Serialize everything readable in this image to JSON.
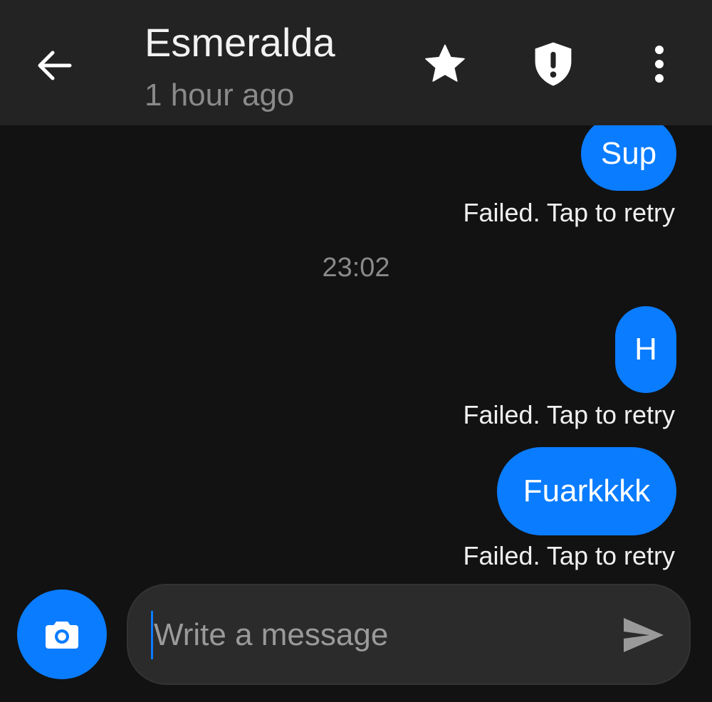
{
  "header": {
    "contact_name": "Esmeralda",
    "last_seen": "1 hour ago",
    "back_icon": "arrow-left-icon",
    "actions": [
      {
        "name": "favorite",
        "icon": "star-icon"
      },
      {
        "name": "security",
        "icon": "shield-alert-icon"
      },
      {
        "name": "more",
        "icon": "more-vertical-icon"
      }
    ]
  },
  "conversation": {
    "messages": [
      {
        "text": "Sup",
        "direction": "outgoing",
        "status": "Failed. Tap to retry"
      },
      {
        "text": "H",
        "direction": "outgoing",
        "status": "Failed. Tap to retry"
      },
      {
        "text": "Fuarkkkk",
        "direction": "outgoing",
        "status": "Failed. Tap to retry"
      }
    ],
    "timestamp": "23:02"
  },
  "composer": {
    "placeholder": "Write a message",
    "value": "",
    "camera_icon": "camera-icon",
    "send_icon": "send-icon"
  },
  "colors": {
    "background": "#121212",
    "app_bar": "#232323",
    "accent": "#0a7cff",
    "secondary_text": "#8a8a8a",
    "composer_bg": "#2b2b2b"
  }
}
